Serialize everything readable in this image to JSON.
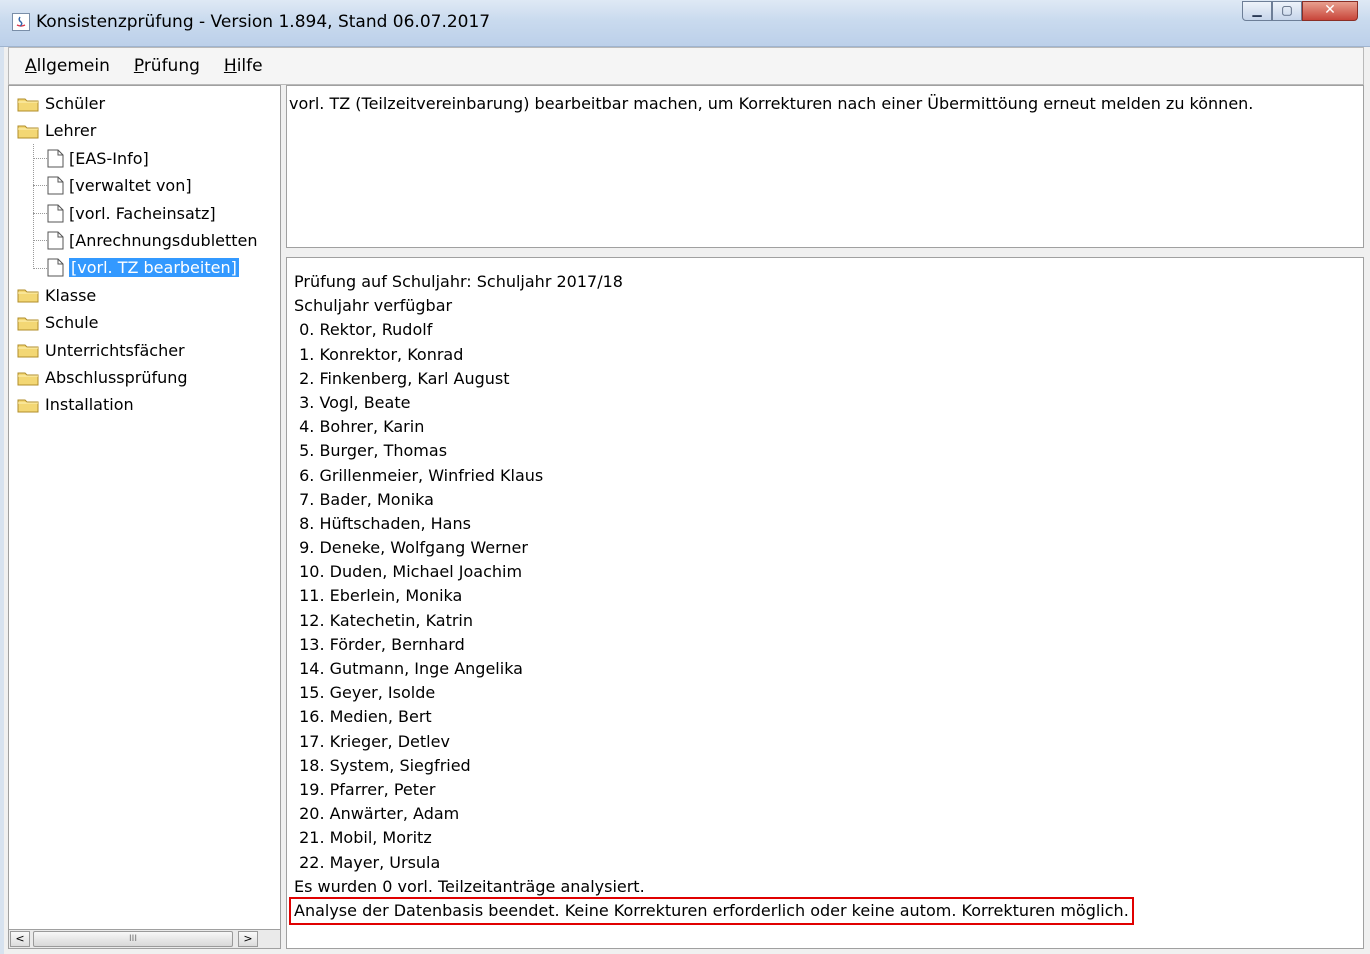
{
  "window": {
    "title": "Konsistenzprüfung - Version 1.894, Stand 06.07.2017",
    "icon": "java-app-icon",
    "controls": {
      "minimize": "minimize-icon",
      "maximize": "maximize-icon",
      "close": "close-icon"
    }
  },
  "menu": [
    {
      "label_u": "A",
      "label_rest": "llgemein"
    },
    {
      "label_u": "P",
      "label_rest": "rüfung"
    },
    {
      "label_u": "H",
      "label_rest": "ilfe"
    }
  ],
  "tree": {
    "nodes": [
      {
        "label": "Schüler",
        "type": "folder"
      },
      {
        "label": "Lehrer",
        "type": "folder"
      },
      {
        "label": "[EAS-Info]",
        "type": "leaf"
      },
      {
        "label": "[verwaltet von]",
        "type": "leaf"
      },
      {
        "label": "[vorl. Facheinsatz]",
        "type": "leaf"
      },
      {
        "label": "[Anrechnungsdubletten",
        "type": "leaf"
      },
      {
        "label": "[vorl. TZ bearbeiten]",
        "type": "leaf",
        "selected": true
      },
      {
        "label": "Klasse",
        "type": "folder"
      },
      {
        "label": "Schule",
        "type": "folder"
      },
      {
        "label": "Unterrichtsfächer",
        "type": "folder"
      },
      {
        "label": "Abschlussprüfung",
        "type": "folder"
      },
      {
        "label": "Installation",
        "type": "folder"
      }
    ],
    "scrollbar": {
      "left_arrow": "<",
      "right_arrow": ">",
      "grip": "III"
    }
  },
  "description": "vorl. TZ (Teilzeitvereinbarung) bearbeitbar machen, um Korrekturen nach einer Übermittöung erneut melden zu können.",
  "log": {
    "lines": [
      "Prüfung auf Schuljahr: Schuljahr 2017/18",
      "Schuljahr verfügbar",
      " 0. Rektor, Rudolf",
      " 1. Konrektor, Konrad",
      " 2. Finkenberg, Karl August",
      " 3. Vogl, Beate",
      " 4. Bohrer, Karin",
      " 5. Burger, Thomas",
      " 6. Grillenmeier, Winfried Klaus",
      " 7. Bader, Monika",
      " 8. Hüftschaden, Hans",
      " 9. Deneke, Wolfgang Werner",
      " 10. Duden, Michael Joachim",
      " 11. Eberlein, Monika",
      " 12. Katechetin, Katrin",
      " 13. Förder, Bernhard",
      " 14. Gutmann, Inge Angelika",
      " 15. Geyer, Isolde",
      " 16. Medien, Bert",
      " 17. Krieger, Detlev",
      " 18. System, Siegfried",
      " 19. Pfarrer, Peter",
      " 20. Anwärter, Adam",
      " 21. Mobil, Moritz",
      " 22. Mayer, Ursula",
      "Es wurden 0 vorl. Teilzeitanträge analysiert."
    ],
    "final_line": "Analyse der Datenbasis beendet. Keine Korrekturen erforderlich oder keine autom. Korrekturen möglich.",
    "highlight_color": "#e00000"
  }
}
